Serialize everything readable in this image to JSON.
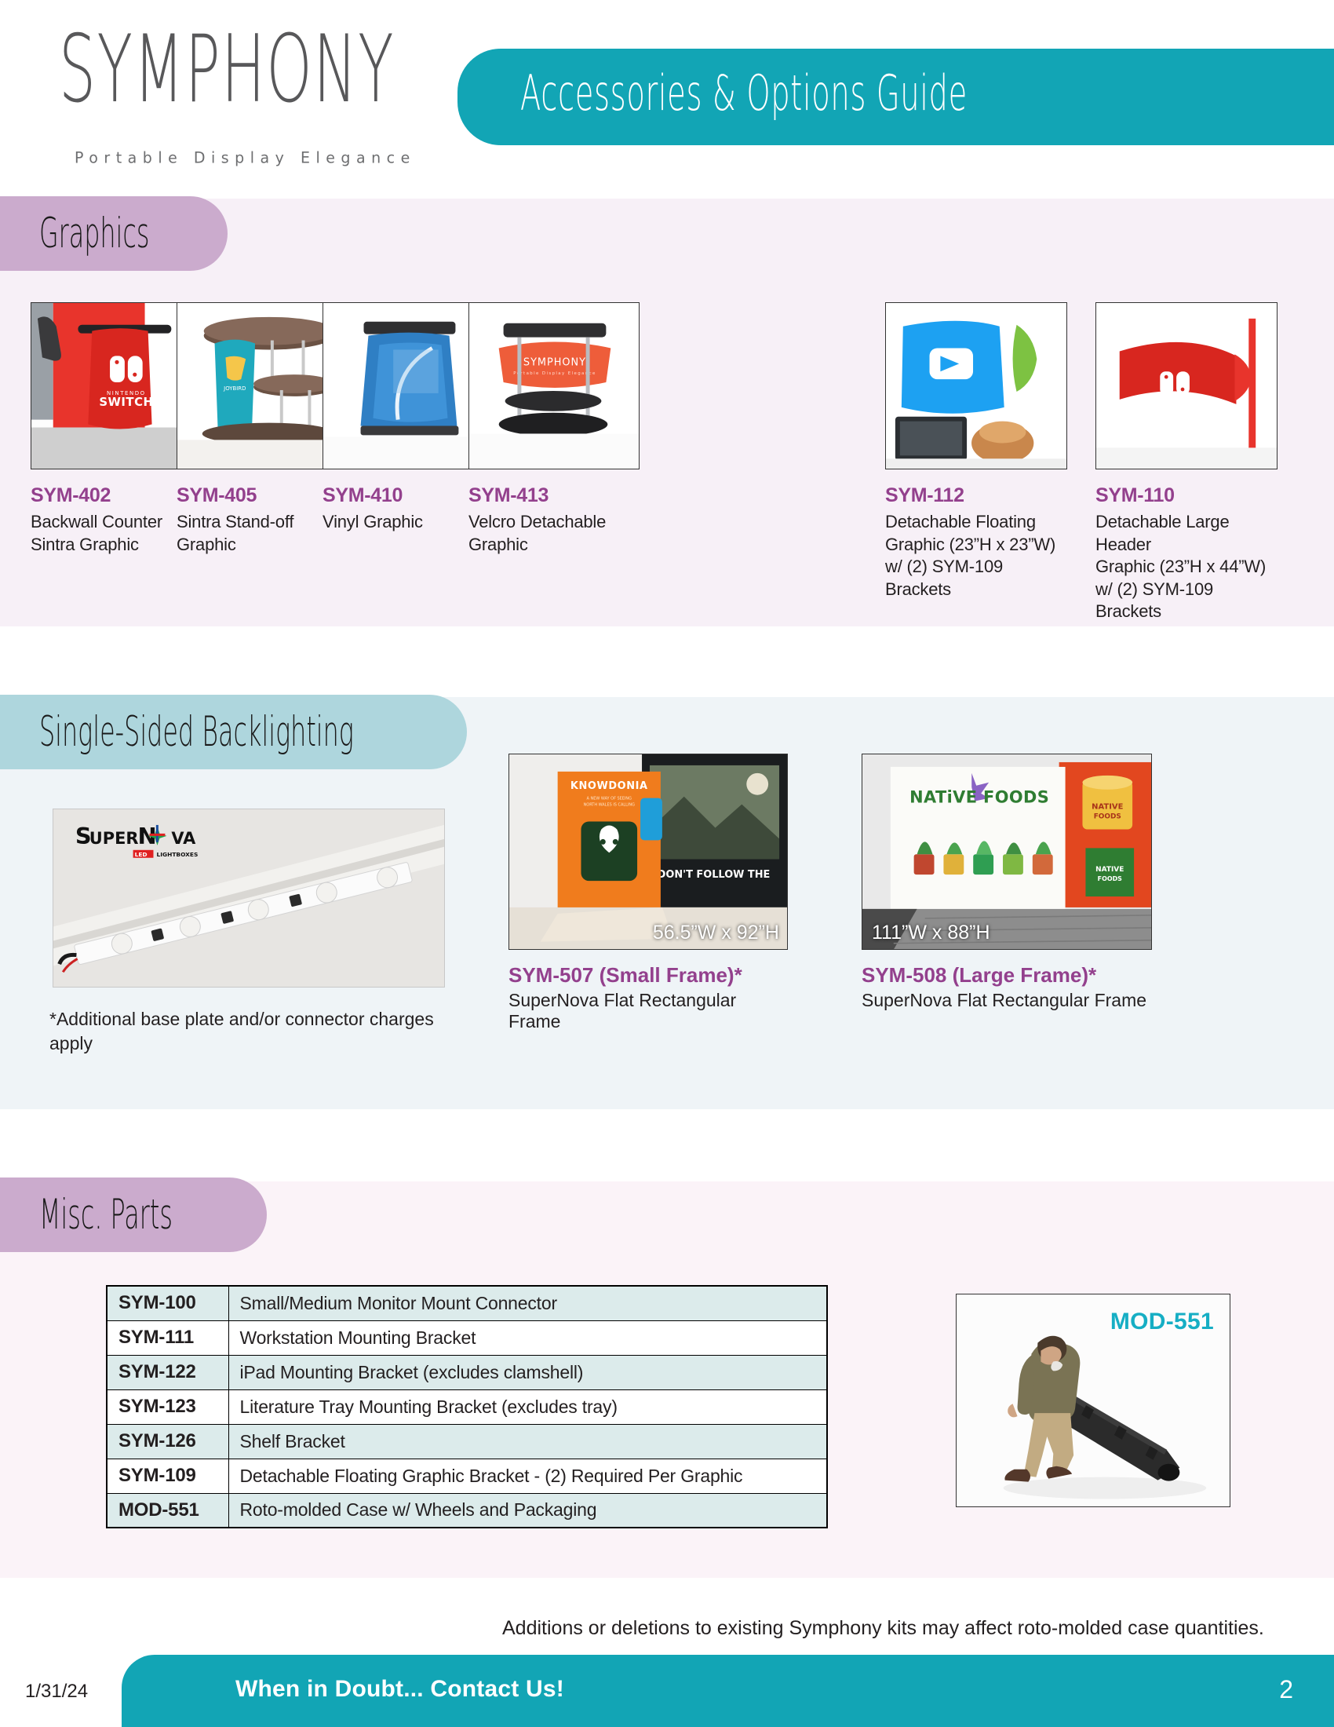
{
  "brand": {
    "logo_word": "SYMPHONY",
    "tagline": "Portable Display Elegance"
  },
  "header": {
    "title": "Accessories & Options Guide",
    "banner_color": "#12a5b5"
  },
  "sections": {
    "graphics": {
      "title": "Graphics",
      "tab_color": "#cbabcd",
      "band_color": "#f7f0f7",
      "products": [
        {
          "sku": "SYM-402",
          "desc": "Backwall Counter\nSintra Graphic",
          "image": "nintendo-switch-red-counter-photo"
        },
        {
          "sku": "SYM-405",
          "desc": "Sintra Stand-off Graphic",
          "image": "joybird-teal-standoff-counter-photo"
        },
        {
          "sku": "SYM-410",
          "desc": "Vinyl Graphic",
          "image": "blue-vinyl-wrapped-counter-photo"
        },
        {
          "sku": "SYM-413",
          "desc": "Velcro Detachable\nGraphic",
          "image": "symphony-orange-velcro-counter-photo"
        },
        {
          "sku": "SYM-112",
          "desc": "Detachable Floating\nGraphic (23”H x 23”W)\nw/ (2) SYM-109 Brackets",
          "image": "vimeo-blue-floating-graphic-photo"
        },
        {
          "sku": "SYM-110",
          "desc": "Detachable Large Header\nGraphic (23”H x 44”W)\nw/ (2) SYM-109 Brackets",
          "image": "nintendo-switch-large-header-photo"
        }
      ]
    },
    "backlighting": {
      "title": "Single-Sided Backlighting",
      "tab_color": "#aed6dd",
      "band_color": "#eff4f7",
      "supernova": {
        "image": "supernova-led-light-bar-photo",
        "logo_text": "SuperNova",
        "logo_sub": "LED LIGHTBOXES",
        "note": "*Additional base plate and/or connector charges apply"
      },
      "frames": [
        {
          "sku": "SYM-507",
          "variant": "(Small Frame)*",
          "desc": "SuperNova Flat Rectangular Frame",
          "dimensions": "56.5”W x 92”H",
          "image": "knowdonia-orange-lightbox-photo"
        },
        {
          "sku": "SYM-508",
          "variant": "(Large Frame)*",
          "desc": "SuperNova Flat Rectangular Frame",
          "dimensions": "111”W x 88”H",
          "image": "native-foods-lightbox-photo"
        }
      ]
    },
    "misc_parts": {
      "title": "Misc. Parts",
      "tab_color": "#cbabcd",
      "band_color": "#fbf3f8",
      "sku_colors": {
        "purple": "#93408d",
        "teal": "#16aec4"
      },
      "rows": [
        {
          "sku": "SYM-100",
          "desc": "Small/Medium Monitor Mount Connector",
          "sku_color": "purple",
          "shaded": true
        },
        {
          "sku": "SYM-111",
          "desc": "Workstation Mounting Bracket",
          "sku_color": "teal",
          "shaded": false
        },
        {
          "sku": "SYM-122",
          "desc": "iPad Mounting Bracket (excludes clamshell)",
          "sku_color": "purple",
          "shaded": true
        },
        {
          "sku": "SYM-123",
          "desc": "Literature Tray Mounting Bracket (excludes tray)",
          "sku_color": "teal",
          "shaded": false
        },
        {
          "sku": "SYM-126",
          "desc": "Shelf Bracket",
          "sku_color": "purple",
          "shaded": true
        },
        {
          "sku": "SYM-109",
          "desc": "Detachable Floating Graphic Bracket - (2) Required Per Graphic",
          "sku_color": "teal",
          "shaded": false
        },
        {
          "sku": "MOD-551",
          "desc": "Roto-molded Case w/ Wheels and Packaging",
          "sku_color": "purple",
          "shaded": true
        }
      ],
      "case_image": {
        "label": "MOD-551",
        "image": "man-pulling-roto-molded-wheeled-case-photo"
      }
    }
  },
  "note_bottom": "Additions or deletions to existing Symphony kits may affect roto-molded case quantities.",
  "footer": {
    "date": "1/31/24",
    "message": "When in Doubt... Contact Us!",
    "page_number": "2",
    "bar_color": "#12a5b5"
  }
}
